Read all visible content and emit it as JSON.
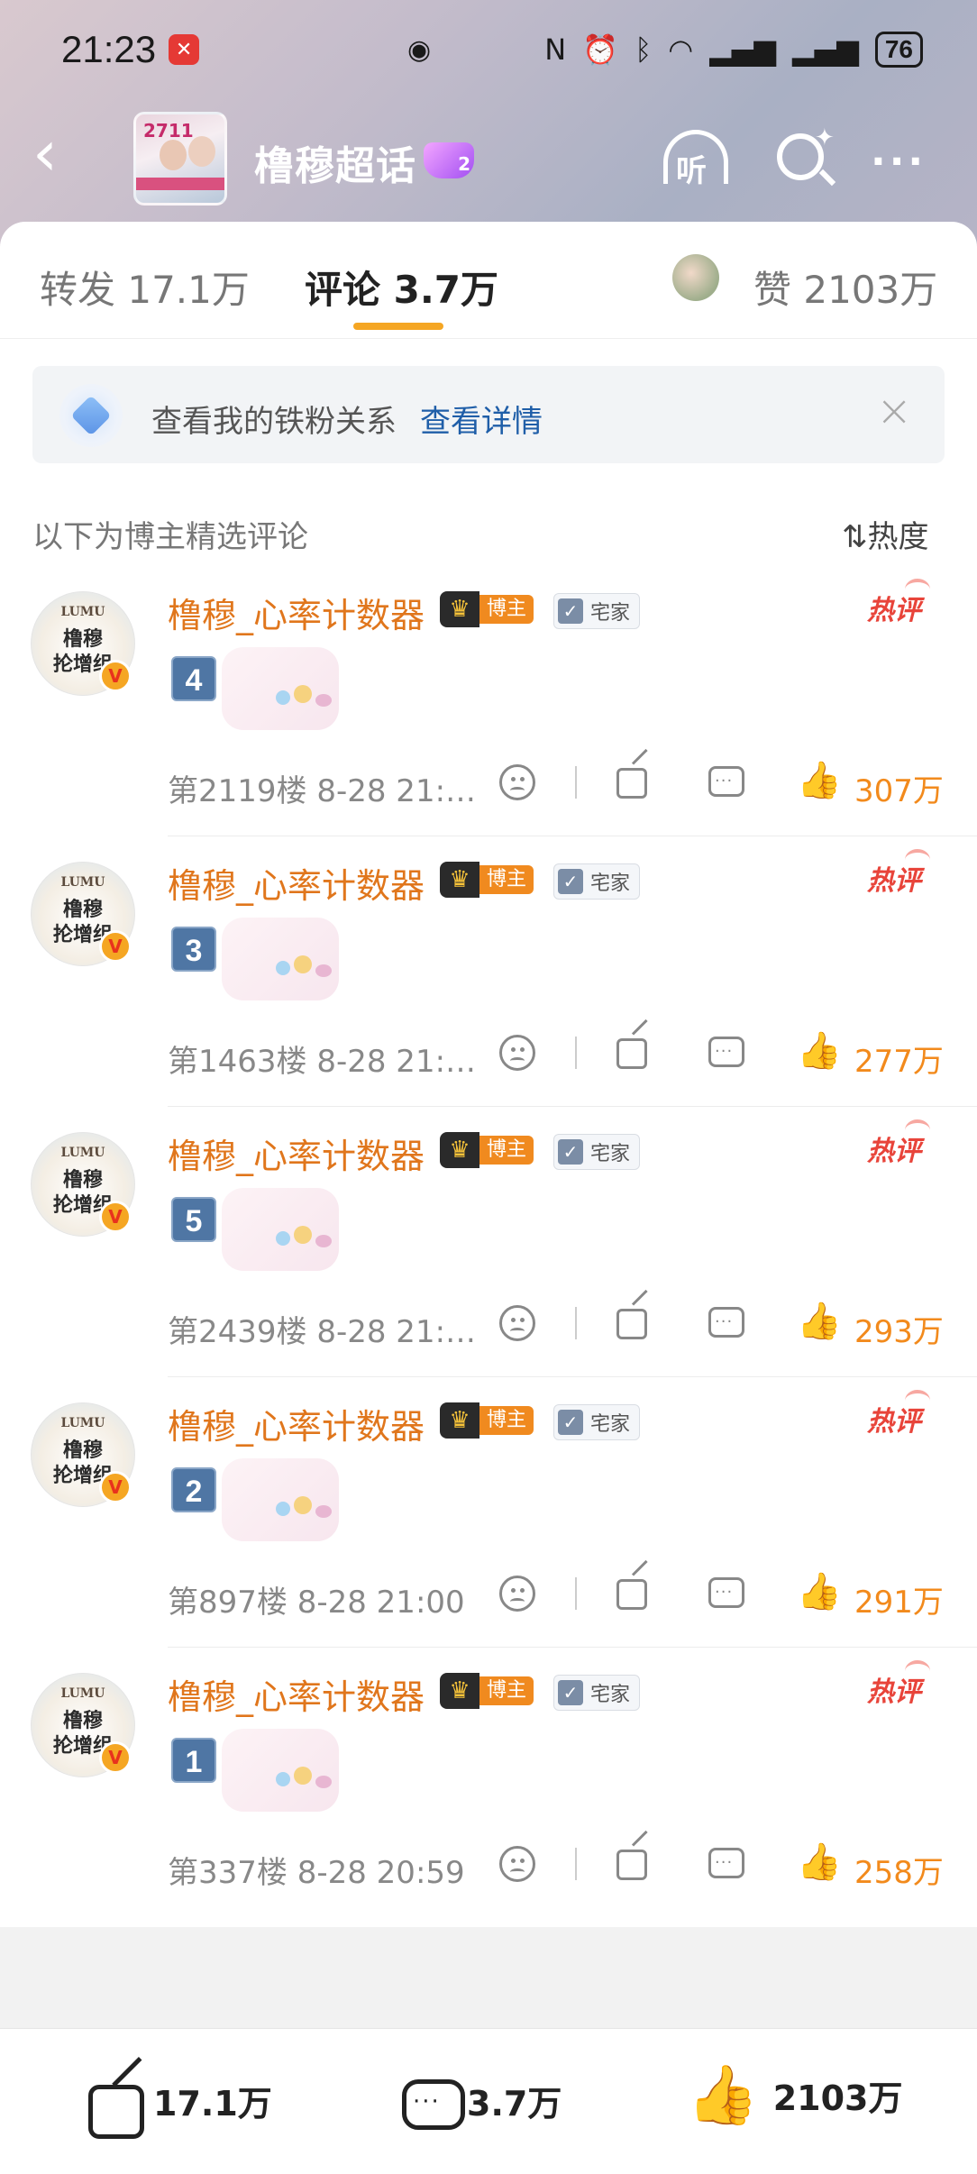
{
  "status_bar": {
    "time": "21:23",
    "alert_icon": "app-alert-icon",
    "center_icon": "data-saver-icon",
    "nfc_label": "N",
    "battery": "76"
  },
  "header": {
    "back_icon": "back-arrow-icon",
    "topic_title": "橹穆超话",
    "topic_badge": "2",
    "thumb_number": "2711",
    "listen_label": "听",
    "search_icon": "ai-search-icon",
    "more_icon": "more-icon"
  },
  "tabs": {
    "repost": "转发 17.1万",
    "comments": "评论 3.7万",
    "likes": "赞 2103万"
  },
  "fan_banner": {
    "text": "查看我的铁粉关系",
    "link": "查看详情",
    "close": "×"
  },
  "section": {
    "label": "以下为博主精选评论",
    "sort": "热度"
  },
  "comments": [
    {
      "name": "橹穆_心率计数器",
      "badge_crown": "博主",
      "badge_home": "宅家",
      "hot": "热评",
      "number": "4",
      "meta": "第2119楼 8-28 21:…",
      "likes": "307万",
      "avatar_top": "LUMU",
      "avatar_mid": "橹穆",
      "avatar_bot": "抡增组"
    },
    {
      "name": "橹穆_心率计数器",
      "badge_crown": "博主",
      "badge_home": "宅家",
      "hot": "热评",
      "number": "3",
      "meta": "第1463楼 8-28 21:…",
      "likes": "277万",
      "avatar_top": "LUMU",
      "avatar_mid": "橹穆",
      "avatar_bot": "抡增组"
    },
    {
      "name": "橹穆_心率计数器",
      "badge_crown": "博主",
      "badge_home": "宅家",
      "hot": "热评",
      "number": "5",
      "meta": "第2439楼 8-28 21:…",
      "likes": "293万",
      "avatar_top": "LUMU",
      "avatar_mid": "橹穆",
      "avatar_bot": "抡增组"
    },
    {
      "name": "橹穆_心率计数器",
      "badge_crown": "博主",
      "badge_home": "宅家",
      "hot": "热评",
      "number": "2",
      "meta": "第897楼 8-28 21:00",
      "likes": "291万",
      "avatar_top": "LUMU",
      "avatar_mid": "橹穆",
      "avatar_bot": "抡增组"
    },
    {
      "name": "橹穆_心率计数器",
      "badge_crown": "博主",
      "badge_home": "宅家",
      "hot": "热评",
      "number": "1",
      "meta": "第337楼 8-28 20:59",
      "likes": "258万",
      "avatar_top": "LUMU",
      "avatar_mid": "橹穆",
      "avatar_bot": "抡增组"
    }
  ],
  "bottom_bar": {
    "repost": "17.1万",
    "comments": "3.7万",
    "likes": "2103万"
  },
  "colors": {
    "accent_orange": "#f28a1c",
    "tab_indicator": "#f5a623",
    "link_blue": "#1f5ea8",
    "hot_red": "#e8443a"
  }
}
